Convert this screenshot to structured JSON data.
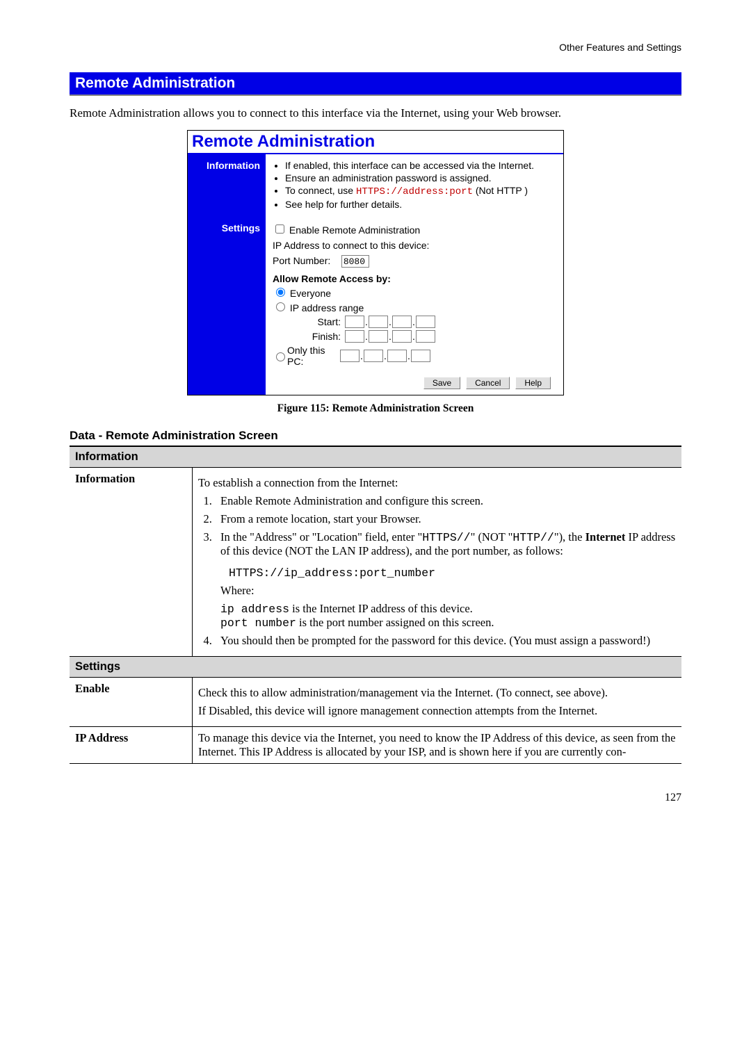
{
  "header": {
    "top_right": "Other Features and Settings"
  },
  "section_title": "Remote Administration",
  "intro": "Remote Administration allows you to connect to this interface via the Internet, using your Web browser.",
  "panel": {
    "title": "Remote Administration",
    "info_label": "Information",
    "info_bullets": {
      "b1": "If enabled, this interface can be accessed via the Internet.",
      "b2": "Ensure an administration password is assigned.",
      "b3_pre": "To connect, use ",
      "b3_code": "HTTPS://address:port",
      "b3_post": "  (Not HTTP )",
      "b4": "See help for further details."
    },
    "settings_label": "Settings",
    "enable_label": "Enable Remote Administration",
    "ip_connect_label": "IP Address to connect to this device:",
    "port_label": "Port Number:",
    "port_value": "8080",
    "allow_label": "Allow Remote Access by:",
    "everyone_label": "Everyone",
    "ip_range_label": "IP address range",
    "start_label": "Start:",
    "finish_label": "Finish:",
    "only_pc_label": "Only this PC:",
    "buttons": {
      "save": "Save",
      "cancel": "Cancel",
      "help": "Help"
    }
  },
  "figure_caption": "Figure 115: Remote Administration Screen",
  "table_title": "Data - Remote Administration Screen",
  "table": {
    "section_info": "Information",
    "row_info_label": "Information",
    "row_info": {
      "p1": "To establish a connection from the Internet:",
      "li1": "Enable Remote Administration and configure this screen.",
      "li2": "From a remote location, start your Browser.",
      "li3_a": "In the \"Address\" or \"Location\" field, enter \"",
      "li3_code1": "HTTPS//",
      "li3_b": "\" (NOT \"",
      "li3_code2": "HTTP//",
      "li3_c": "\"), the ",
      "li3_bold": "Internet",
      "li3_d": " IP address of this device (NOT the LAN IP address), and the port number, as follows:",
      "code_line": "HTTPS://ip_address:port_number",
      "where": "Where:",
      "where_ip_code": "ip address",
      "where_ip_text": " is the Internet IP address of this device.",
      "where_port_code": "port number",
      "where_port_text": " is the port number assigned on this screen.",
      "li4": "You should then be prompted for the password for this device. (You must assign a password!)"
    },
    "section_settings": "Settings",
    "row_enable_label": "Enable",
    "row_enable_p1": "Check this to allow administration/management via the Internet. (To connect, see above).",
    "row_enable_p2": "If Disabled, this device will ignore management connection attempts from the Internet.",
    "row_ip_label": "IP Address",
    "row_ip_text": "To manage this device via the Internet, you need to know the IP Address of this device, as seen from the Internet. This IP Address is allocated by your ISP, and is shown here if you are currently con-"
  },
  "page_number": "127"
}
